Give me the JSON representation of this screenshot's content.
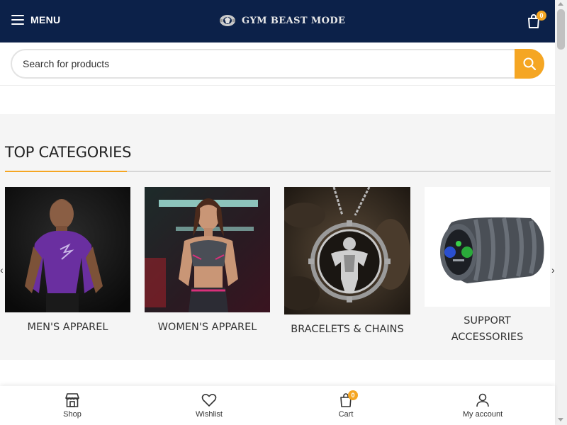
{
  "header": {
    "menu_label": "MENU",
    "brand": "GYM BEAST MODE",
    "cart_count": "0",
    "background": "#0c2149"
  },
  "search": {
    "placeholder": "Search for products",
    "button_color": "#f5a623"
  },
  "categories": {
    "title": "TOP CATEGORIES",
    "items": [
      {
        "label": "MEN'S APPAREL",
        "image": "man-purple-shirt"
      },
      {
        "label": "WOMEN'S APPAREL",
        "image": "woman-sports-bra"
      },
      {
        "label": "BRACELETS & CHAINS",
        "image": "bodybuilder-pendant"
      },
      {
        "label_line1": "SUPPORT",
        "label_line2": "ACCESSORIES",
        "image": "foam-roller"
      }
    ],
    "prev_arrow": "‹",
    "next_arrow": "›"
  },
  "bottom_nav": {
    "items": [
      {
        "label": "Shop",
        "icon": "store-icon"
      },
      {
        "label": "Wishlist",
        "icon": "heart-icon"
      },
      {
        "label": "Cart",
        "icon": "bag-icon",
        "badge": "0"
      },
      {
        "label": "My account",
        "icon": "user-icon"
      }
    ]
  },
  "accent_color": "#f5a623"
}
